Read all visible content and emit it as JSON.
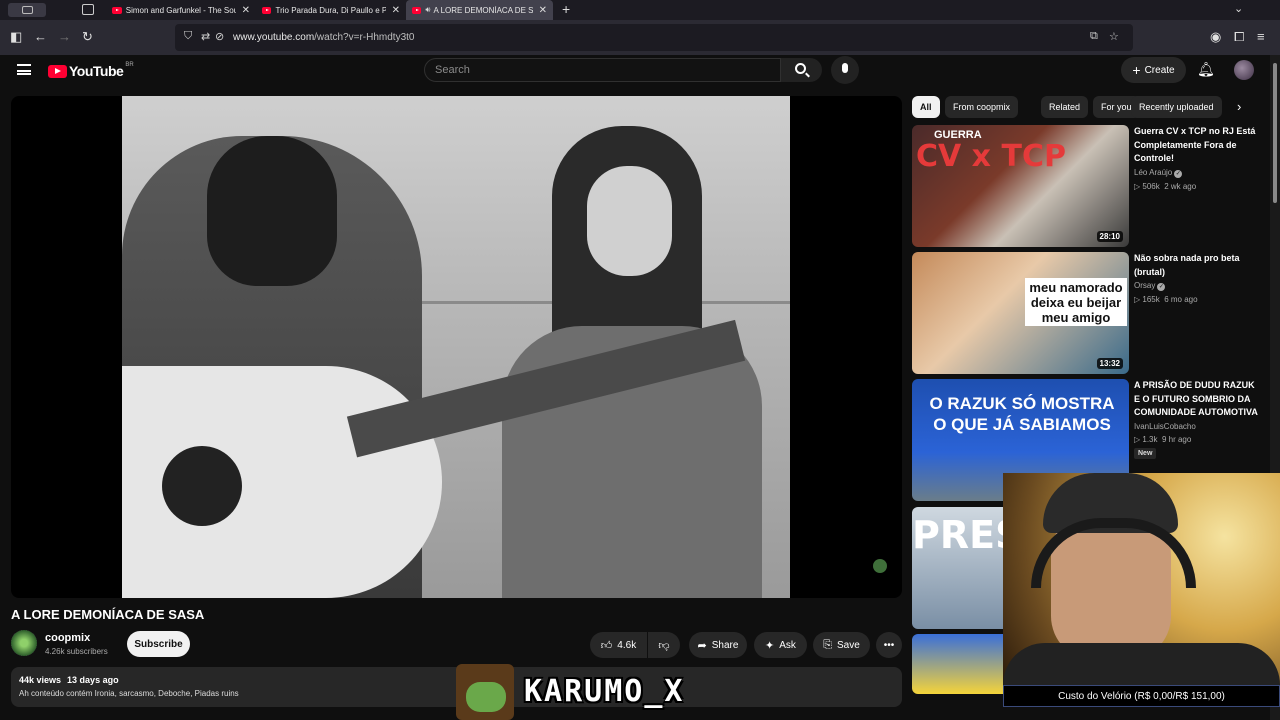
{
  "browser": {
    "tabs": [
      {
        "title": "Simon and Garfunkel - The Sou",
        "active": false
      },
      {
        "title": "Trio Parada Dura, Di Paullo e Pa",
        "active": false
      },
      {
        "title": "A LORE DEMONÍACA DE SA",
        "active": true
      }
    ],
    "url_domain": "www.youtube.com",
    "url_path": "/watch?v=r-Hhmdty3t0"
  },
  "youtube": {
    "logo_text": "YouTube",
    "country_code": "BR",
    "search_placeholder": "Search",
    "create_label": "Create"
  },
  "video": {
    "title": "A LORE DEMONÍACA DE SASA",
    "channel": "coopmix",
    "subscribers": "4.26k subscribers",
    "subscribe_label": "Subscribe",
    "likes": "4.6k",
    "share_label": "Share",
    "ask_label": "Ask",
    "save_label": "Save",
    "views": "44k views",
    "age": "13 days ago",
    "description": "Ah conteúdo contém Ironia, sarcasmo, Deboche, Piadas ruins"
  },
  "chips": [
    "All",
    "From coopmix",
    "Related",
    "For you",
    "Recently uploaded"
  ],
  "recommendations": [
    {
      "title": "Guerra CV x TCP no RJ Está Completamente Fora de Controle!",
      "channel": "Léo Araújo",
      "verified": true,
      "views": "506k",
      "age": "2 wk ago",
      "duration": "28:10",
      "thumb_text": "CV x TCP",
      "thumb_sub": "GUERRA"
    },
    {
      "title": "Não sobra nada pro beta (brutal)",
      "channel": "Orsay",
      "verified": true,
      "views": "165k",
      "age": "6 mo ago",
      "duration": "13:32",
      "thumb_text": "meu namorado deixa eu beijar meu amigo"
    },
    {
      "title": "A PRISÃO DE DUDU RAZUK E O FUTURO SOMBRIO DA COMUNIDADE AUTOMOTIVA",
      "channel": "IvanLuisCobacho",
      "verified": false,
      "views": "1.3k",
      "age": "9 hr ago",
      "badge": "New",
      "thumb_text": "O RAZUK SÓ MOSTRA O QUE JÁ SABIAMOS"
    },
    {
      "thumb_text": "PRES"
    }
  ],
  "overlay": {
    "cost_label": "Custo do Velório (R$ 0,00/R$ 151,00)",
    "streamer_name": "KARUMO_X"
  }
}
